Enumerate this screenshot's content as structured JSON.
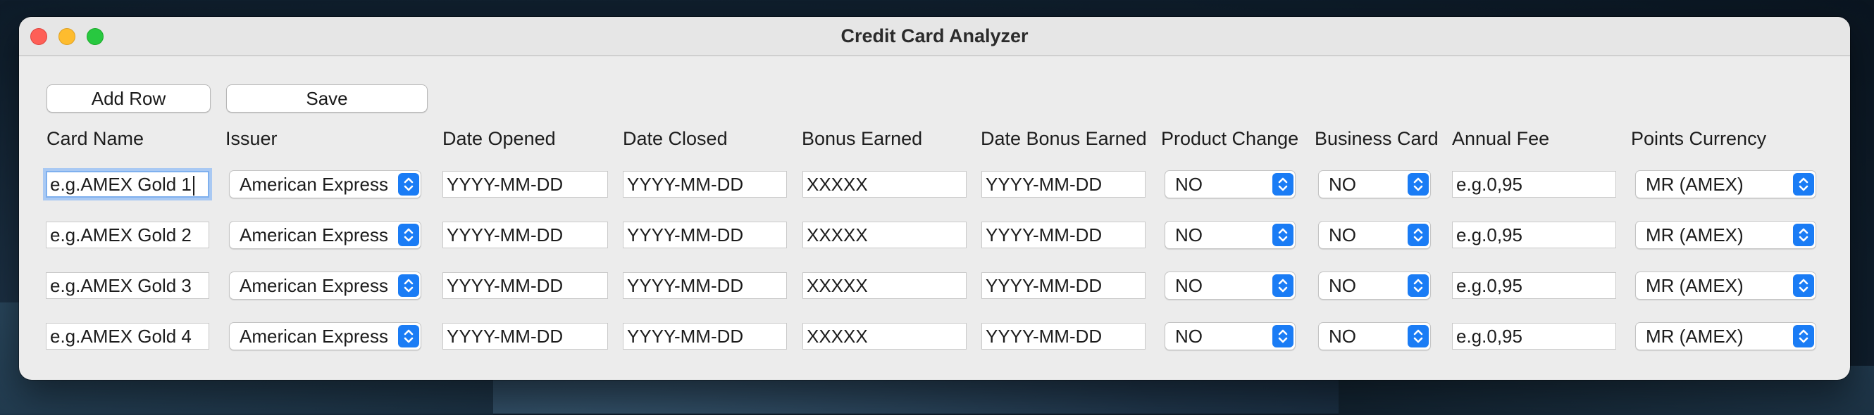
{
  "window": {
    "title": "Credit Card Analyzer"
  },
  "toolbar": {
    "add_row_label": "Add Row",
    "save_label": "Save"
  },
  "columns": [
    "Card Name",
    "Issuer",
    "Date Opened",
    "Date Closed",
    "Bonus Earned",
    "Date Bonus Earned",
    "Product Change",
    "Business Card",
    "Annual Fee",
    "Points Currency"
  ],
  "rows": [
    {
      "card_name": "e.g.AMEX Gold 1",
      "issuer": "American Express",
      "date_opened": "YYYY-MM-DD",
      "date_closed": "YYYY-MM-DD",
      "bonus_earned": "XXXXX",
      "date_bonus_earned": "YYYY-MM-DD",
      "product_change": "NO",
      "business_card": "NO",
      "annual_fee": "e.g.0,95",
      "points_currency": "MR (AMEX)"
    },
    {
      "card_name": "e.g.AMEX Gold 2",
      "issuer": "American Express",
      "date_opened": "YYYY-MM-DD",
      "date_closed": "YYYY-MM-DD",
      "bonus_earned": "XXXXX",
      "date_bonus_earned": "YYYY-MM-DD",
      "product_change": "NO",
      "business_card": "NO",
      "annual_fee": "e.g.0,95",
      "points_currency": "MR (AMEX)"
    },
    {
      "card_name": "e.g.AMEX Gold 3",
      "issuer": "American Express",
      "date_opened": "YYYY-MM-DD",
      "date_closed": "YYYY-MM-DD",
      "bonus_earned": "XXXXX",
      "date_bonus_earned": "YYYY-MM-DD",
      "product_change": "NO",
      "business_card": "NO",
      "annual_fee": "e.g.0,95",
      "points_currency": "MR (AMEX)"
    },
    {
      "card_name": "e.g.AMEX Gold 4",
      "issuer": "American Express",
      "date_opened": "YYYY-MM-DD",
      "date_closed": "YYYY-MM-DD",
      "bonus_earned": "XXXXX",
      "date_bonus_earned": "YYYY-MM-DD",
      "product_change": "NO",
      "business_card": "NO",
      "annual_fee": "e.g.0,95",
      "points_currency": "MR (AMEX)"
    }
  ],
  "colors": {
    "accent": "#1a7cf5",
    "focus_ring": "#a9c9f3",
    "close": "#fe5f57",
    "minimize": "#febc2e",
    "maximize": "#28c840"
  },
  "icons": {
    "close": "close-icon",
    "minimize": "minimize-icon",
    "maximize": "maximize-icon",
    "popup_arrows": "chevron-up-down-icon"
  }
}
